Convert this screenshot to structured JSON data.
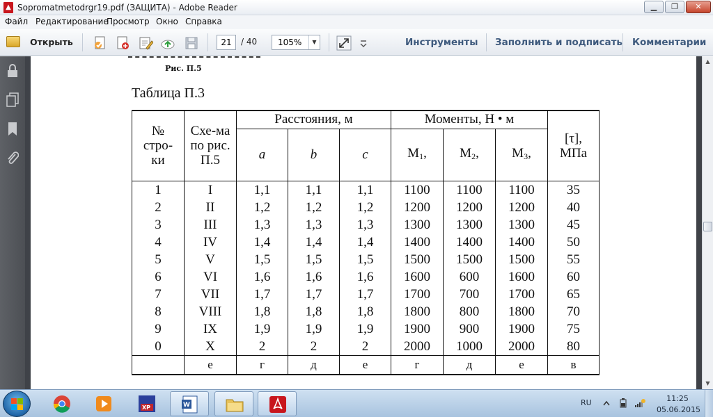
{
  "window": {
    "title": "Sopromatmetodrgr19.pdf (ЗАЩИТА) - Adobe Reader",
    "minimize_icon": "minimize-icon",
    "maximize_icon": "restore-icon",
    "close_icon": "close-icon"
  },
  "menu": {
    "items": [
      "Файл",
      "Редактирование",
      "Просмотр",
      "Окно",
      "Справка"
    ]
  },
  "toolbar": {
    "open_label": "Открыть",
    "page_current": "21",
    "page_total": "/ 40",
    "zoom": "105%",
    "tools_label": "Инструменты",
    "fill_sign_label": "Заполнить и подписать",
    "comments_label": "Комментарии"
  },
  "document": {
    "figure_caption": "Рис. П.5",
    "table_title": "Таблица П.3",
    "table": {
      "h_num": "№ стро-ки",
      "h_scheme": "Схе-ма по рис. П.5",
      "h_distances": "Расстояния, м",
      "h_moments": "Моменты, Н • м",
      "h_tau": "[τ], МПа",
      "h_a": "a",
      "h_b": "b",
      "h_c": "c",
      "h_m1": "M",
      "h_m1_sub": "1",
      "h_m2": "M",
      "h_m2_sub": "2",
      "h_m3": "M",
      "h_m3_sub": "3",
      "h_m_suffix": ",",
      "rows": [
        [
          "1",
          "I",
          "1,1",
          "1,1",
          "1,1",
          "1100",
          "1100",
          "1100",
          "35"
        ],
        [
          "2",
          "II",
          "1,2",
          "1,2",
          "1,2",
          "1200",
          "1200",
          "1200",
          "40"
        ],
        [
          "3",
          "III",
          "1,3",
          "1,3",
          "1,3",
          "1300",
          "1300",
          "1300",
          "45"
        ],
        [
          "4",
          "IV",
          "1,4",
          "1,4",
          "1,4",
          "1400",
          "1400",
          "1400",
          "50"
        ],
        [
          "5",
          "V",
          "1,5",
          "1,5",
          "1,5",
          "1500",
          "1500",
          "1500",
          "55"
        ],
        [
          "6",
          "VI",
          "1,6",
          "1,6",
          "1,6",
          "1600",
          "600",
          "1600",
          "60"
        ],
        [
          "7",
          "VII",
          "1,7",
          "1,7",
          "1,7",
          "1700",
          "700",
          "1700",
          "65"
        ],
        [
          "8",
          "VIII",
          "1,8",
          "1,8",
          "1,8",
          "1800",
          "800",
          "1800",
          "70"
        ],
        [
          "9",
          "IX",
          "1,9",
          "1,9",
          "1,9",
          "1900",
          "900",
          "1900",
          "75"
        ],
        [
          "0",
          "X",
          "2",
          "2",
          "2",
          "2000",
          "1000",
          "2000",
          "80"
        ]
      ],
      "footer": [
        "",
        "е",
        "г",
        "д",
        "е",
        "г",
        "д",
        "е",
        "в"
      ]
    }
  },
  "taskbar": {
    "language": "RU",
    "time": "11:25",
    "date": "05.06.2015",
    "apps": [
      "chrome-icon",
      "media-player-icon",
      "xp-save-icon",
      "word-icon",
      "file-explorer-icon",
      "adobe-reader-icon"
    ]
  },
  "colors": {
    "toolbar_link": "#3e5a7d",
    "nav_pane": "#55585d",
    "doc_background": "#3f4248",
    "taskbar": "#b8cfe6"
  }
}
